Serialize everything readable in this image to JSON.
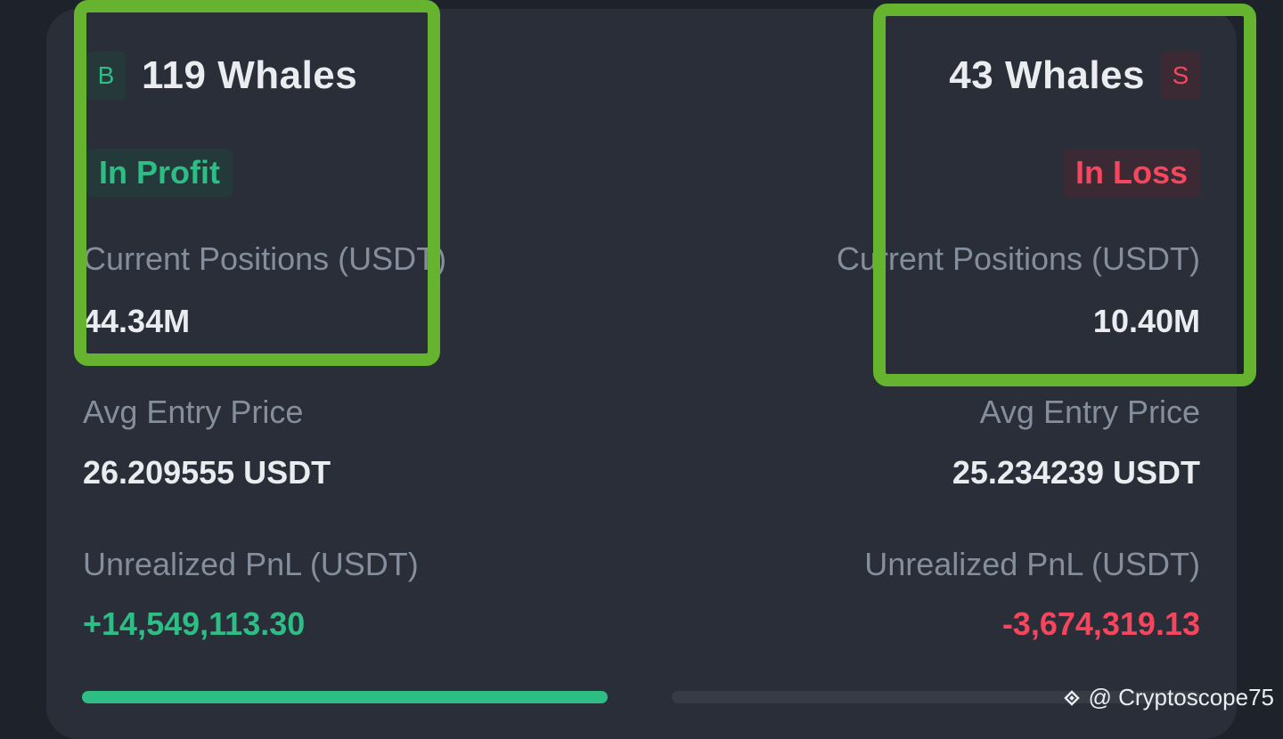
{
  "buy_side": {
    "letter": "B",
    "whales": "119 Whales",
    "status": "In Profit",
    "positions_label": "Current Positions (USDT)",
    "positions_value": "44.34M",
    "avg_entry_label": "Avg Entry Price",
    "avg_entry_value": "26.209555 USDT",
    "pnl_label": "Unrealized PnL (USDT)",
    "pnl_value": "+14,549,113.30"
  },
  "sell_side": {
    "letter": "S",
    "whales": "43 Whales",
    "status": "In Loss",
    "positions_label": "Current Positions (USDT)",
    "positions_value": "10.40M",
    "avg_entry_label": "Avg Entry Price",
    "avg_entry_value": "25.234239 USDT",
    "pnl_label": "Unrealized PnL (USDT)",
    "pnl_value": "-3,674,319.13"
  },
  "ratio_bar": {
    "buy_fraction": 0.81
  },
  "watermark": {
    "icon": "binance-diamond-icon",
    "text": "@ Cryptoscope75"
  },
  "colors": {
    "profit": "#2ebd85",
    "loss": "#f6465d",
    "highlight": "#65b32e",
    "card_bg": "#292e38"
  }
}
